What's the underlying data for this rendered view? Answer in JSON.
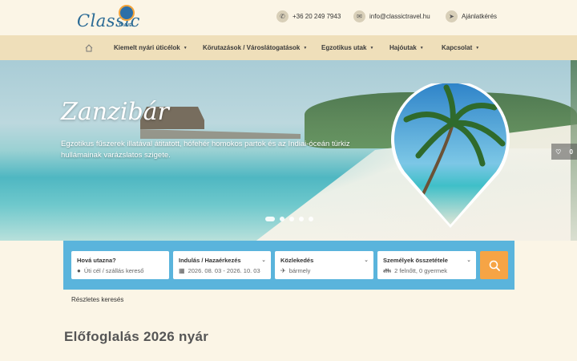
{
  "logo": {
    "text": "Classic",
    "badge": "TRAVEL"
  },
  "contact": {
    "phone": "+36 20 249 7943",
    "email": "info@classictravel.hu",
    "quote": "Ajánlatkérés"
  },
  "nav": {
    "items": [
      {
        "label": "Kiemelt nyári úticélok"
      },
      {
        "label": "Körutazások / Városlátogatások"
      },
      {
        "label": "Egzotikus utak"
      },
      {
        "label": "Hajóutak"
      },
      {
        "label": "Kapcsolat"
      }
    ]
  },
  "hero": {
    "title": "Zanzibár",
    "description": "Egzotikus fűszerek illatával átitatott, hófehér homokos partok és az Indiai-óceán türkiz hullámainak varázslatos szigete.",
    "slide_count": 5,
    "active_slide": 1,
    "favorites_count": "0"
  },
  "search": {
    "fields": [
      {
        "label": "Hová utazna?",
        "value": "Úti cél / szállás kereső",
        "icon": "map-marker-icon"
      },
      {
        "label": "Indulás / Hazaérkezés",
        "value": "2026. 08. 03 - 2026. 10. 03",
        "icon": "calendar-icon"
      },
      {
        "label": "Közlekedés",
        "value": "bármely",
        "icon": "transport-icon"
      },
      {
        "label": "Személyek összetétele",
        "value": "2 felnőtt, 0 gyermek",
        "icon": "people-icon"
      }
    ]
  },
  "links": {
    "detailed_search": "Részletes keresés"
  },
  "section": {
    "title": "Előfoglalás 2026 nyár"
  },
  "colors": {
    "background": "#fbf5e6",
    "nav": "#efdfba",
    "search_bar": "#5ab4dc",
    "search_button": "#f6a445"
  }
}
